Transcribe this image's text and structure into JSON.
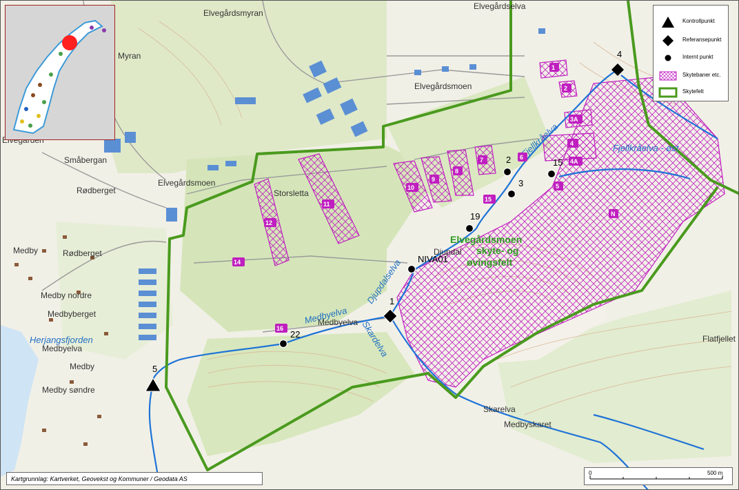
{
  "map": {
    "place_names": [
      "Elvegårdsmyran",
      "Elvegårdselva",
      "Elvegårdsmoen",
      "Myran",
      "Elvegården",
      "Småbergan",
      "Elvegårdsmoen",
      "Rødberget",
      "Storsletta",
      "Medby",
      "Rødberget",
      "Medby nordre",
      "Medbyberget",
      "Medbyelva",
      "Medby",
      "Medby søndre",
      "Djupdal",
      "Skarelva",
      "Medbyskaret",
      "Flatfjellet"
    ],
    "water_names": [
      "Fjellkråelva",
      "Fjellkråelva - øst",
      "Djupdalselva",
      "Medbyelva",
      "Skardelva",
      "Herjangsfjorden"
    ],
    "field_name_line1": "Elvegårdsmoen",
    "field_name_line2": "skyte- og",
    "field_name_line3": "øvingsfelt",
    "points": [
      {
        "id": "4",
        "type": "referansepunkt"
      },
      {
        "id": "2",
        "type": "internt"
      },
      {
        "id": "3",
        "type": "internt"
      },
      {
        "id": "15",
        "type": "internt"
      },
      {
        "id": "19",
        "type": "internt"
      },
      {
        "id": "NIVA01",
        "type": "internt"
      },
      {
        "id": "1",
        "type": "referansepunkt"
      },
      {
        "id": "22",
        "type": "internt"
      },
      {
        "id": "5",
        "type": "kontrollpunkt"
      }
    ],
    "range_tags": [
      "1",
      "2",
      "3A",
      "4",
      "4A",
      "5",
      "6",
      "7",
      "8",
      "9",
      "10",
      "11",
      "12",
      "14",
      "15",
      "16",
      "N"
    ]
  },
  "legend": {
    "items": [
      {
        "label": "Kontrollpunkt",
        "symbol": "triangle"
      },
      {
        "label": "Referansepunkt",
        "symbol": "diamond"
      },
      {
        "label": "Internt punkt",
        "symbol": "dot"
      },
      {
        "label": "Skytebaner etc.",
        "symbol": "magenta-hatch"
      },
      {
        "label": "Skytefelt",
        "symbol": "green-outline"
      }
    ]
  },
  "credit": "Kartgrunnlag: Kartverket, Geovekst og Kommuner / Geodata AS",
  "scale": {
    "start": "0",
    "end": "500 m"
  },
  "colors": {
    "base": "#f0efe6",
    "forest": "#d5e5b9",
    "water": "#1e73d6",
    "boundary": "#4a9a1e",
    "range": "#c01fc0",
    "building": "#5b8fd4"
  }
}
